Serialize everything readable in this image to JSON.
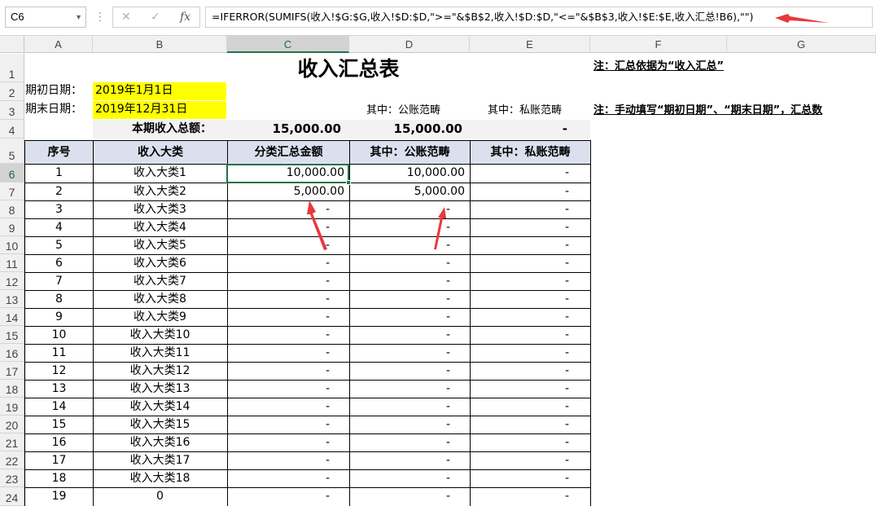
{
  "formula_bar": {
    "name_box": "C6",
    "formula": "=IFERROR(SUMIFS(收入!$G:$G,收入!$D:$D,\">=\"&$B$2,收入!$D:$D,\"<=\"&$B$3,收入!$E:$E,收入汇总!B6),\"\")"
  },
  "columns": [
    "A",
    "B",
    "C",
    "D",
    "E",
    "F",
    "G"
  ],
  "rows": [
    "1",
    "2",
    "3",
    "4",
    "5",
    "6",
    "7",
    "8",
    "9",
    "10",
    "11",
    "12",
    "13",
    "14",
    "15",
    "16",
    "17",
    "18",
    "19",
    "20",
    "21",
    "22",
    "23",
    "24"
  ],
  "sheet": {
    "title": "收入汇总表",
    "note1": "注：汇总依据为“收入汇总”",
    "note2": "注：手动填写“期初日期”、“期末日期”，汇总数",
    "start_label": "期初日期：",
    "start_value": "2019年1月1日",
    "end_label": "期末日期：",
    "end_value": "2019年12月31日",
    "public_note": "其中：公账范畴",
    "private_note": "其中：私账范畴",
    "total_label": "本期收入总额：",
    "total_c": "15,000.00",
    "total_d": "15,000.00",
    "total_e": "-",
    "headers": [
      "序号",
      "收入大类",
      "分类汇总金额",
      "其中：公账范畴",
      "其中：私账范畴"
    ],
    "table_rows": [
      [
        "1",
        "收入大类1",
        "10,000.00",
        "10,000.00",
        "-"
      ],
      [
        "2",
        "收入大类2",
        "5,000.00",
        "5,000.00",
        "-"
      ],
      [
        "3",
        "收入大类3",
        "-",
        "-",
        "-"
      ],
      [
        "4",
        "收入大类4",
        "-",
        "-",
        "-"
      ],
      [
        "5",
        "收入大类5",
        "-",
        "-",
        "-"
      ],
      [
        "6",
        "收入大类6",
        "-",
        "-",
        "-"
      ],
      [
        "7",
        "收入大类7",
        "-",
        "-",
        "-"
      ],
      [
        "8",
        "收入大类8",
        "-",
        "-",
        "-"
      ],
      [
        "9",
        "收入大类9",
        "-",
        "-",
        "-"
      ],
      [
        "10",
        "收入大类10",
        "-",
        "-",
        "-"
      ],
      [
        "11",
        "收入大类11",
        "-",
        "-",
        "-"
      ],
      [
        "12",
        "收入大类12",
        "-",
        "-",
        "-"
      ],
      [
        "13",
        "收入大类13",
        "-",
        "-",
        "-"
      ],
      [
        "14",
        "收入大类14",
        "-",
        "-",
        "-"
      ],
      [
        "15",
        "收入大类15",
        "-",
        "-",
        "-"
      ],
      [
        "16",
        "收入大类16",
        "-",
        "-",
        "-"
      ],
      [
        "17",
        "收入大类17",
        "-",
        "-",
        "-"
      ],
      [
        "18",
        "收入大类18",
        "-",
        "-",
        "-"
      ],
      [
        "19",
        "0",
        "-",
        "-",
        "-"
      ]
    ]
  },
  "colors": {
    "accent": "#217346",
    "header_fill": "#dbe0ee",
    "date_fill": "#ffff00",
    "arrow": "#e8383d"
  }
}
